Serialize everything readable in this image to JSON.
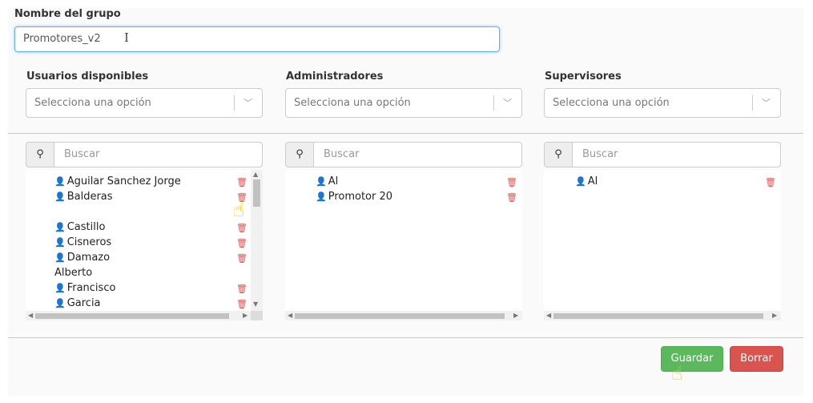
{
  "form": {
    "group_label": "Nombre del grupo",
    "group_value": "Promotores_v2",
    "text_cursor": "I"
  },
  "columns": [
    {
      "label": "Usuarios disponibles",
      "select_placeholder": "Selecciona una opción",
      "search_placeholder": "Buscar"
    },
    {
      "label": "Administradores",
      "select_placeholder": "Selecciona una opción",
      "search_placeholder": "Buscar"
    },
    {
      "label": "Supervisores",
      "select_placeholder": "Selecciona una opción",
      "search_placeholder": "Buscar"
    }
  ],
  "lists": {
    "available": [
      "Aguilar Sanchez Jorge",
      "Balderas",
      "Castillo",
      "Cisneros",
      "Damazo",
      "Alberto",
      "Francisco",
      "Garcia"
    ],
    "admins": [
      "Al",
      "Promotor 20"
    ],
    "supervisors": [
      "Al"
    ]
  },
  "icons": {
    "user": "user-icon",
    "trash": "trash-icon",
    "search": "search-icon",
    "chevron": "chevron-down-icon",
    "pointer": "hand-pointer-icon"
  },
  "glyphs": {
    "user": "👤",
    "trash": "🗑",
    "search": "⚲",
    "chevron": "﹀",
    "hand": "☝",
    "arrow_up": "▲",
    "arrow_down": "▼",
    "arrow_left": "◀",
    "arrow_right": "▶"
  },
  "buttons": {
    "save": "Guardar",
    "clear": "Borrar"
  },
  "colors": {
    "save": "#5cb85c",
    "clear": "#d9534f",
    "trash": "#d9534f",
    "focus_border": "#66afe9"
  }
}
